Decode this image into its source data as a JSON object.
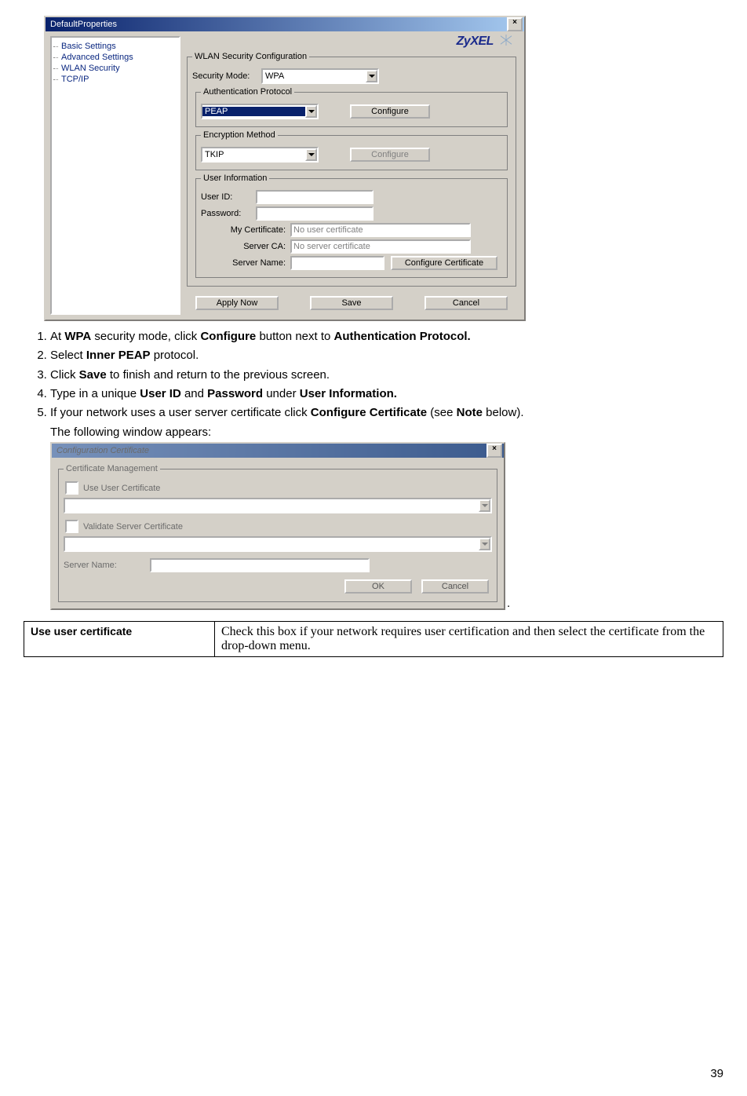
{
  "dlg1": {
    "title": "DefaultProperties",
    "brand": "ZyXEL",
    "tree": [
      "Basic Settings",
      "Advanced Settings",
      "WLAN Security",
      "TCP/IP"
    ],
    "group_wlan": "WLAN Security Configuration",
    "security_mode_label": "Security Mode:",
    "security_mode_value": "WPA",
    "group_auth": "Authentication Protocol",
    "auth_value": "PEAP",
    "auth_configure": "Configure",
    "group_enc": "Encryption Method",
    "enc_value": "TKIP",
    "enc_configure": "Configure",
    "group_user": "User Information",
    "user_id_label": "User ID:",
    "password_label": "Password:",
    "my_cert_label": "My Certificate:",
    "my_cert_value": "No user certificate",
    "server_ca_label": "Server CA:",
    "server_ca_value": "No server certificate",
    "server_name_label": "Server Name:",
    "config_cert_btn": "Configure Certificate",
    "apply_btn": "Apply Now",
    "save_btn": "Save",
    "cancel_btn": "Cancel"
  },
  "steps": {
    "s1a": "At ",
    "s1b": "WPA",
    "s1c": " security mode, click ",
    "s1d": "Configure",
    "s1e": " button next to ",
    "s1f": "Authentication Protocol.",
    "s2a": "Select ",
    "s2b": "Inner PEAP",
    "s2c": " protocol.",
    "s3a": "Click ",
    "s3b": "Save",
    "s3c": " to finish and return to the previous screen.",
    "s4a": "Type in a unique ",
    "s4b": "User ID",
    "s4c": " and ",
    "s4d": "Password",
    "s4e": " under ",
    "s4f": "User Information.",
    "s5a": "If your network uses a user server certificate click ",
    "s5b": "Configure Certificate",
    "s5c": " (see ",
    "s5d": "Note",
    "s5e": " below).",
    "s5sub": "The following window appears:"
  },
  "dlg2": {
    "title": "Configuration Certificate",
    "group": "Certificate Management",
    "use_user": "Use User Certificate",
    "validate": "Validate Server Certificate",
    "server_name_label": "Server Name:",
    "ok": "OK",
    "cancel": "Cancel"
  },
  "table": {
    "term": "Use user certificate",
    "desc": "Check this box if your network requires user certification and then select the certificate from the drop-down menu."
  },
  "page_number": "39"
}
